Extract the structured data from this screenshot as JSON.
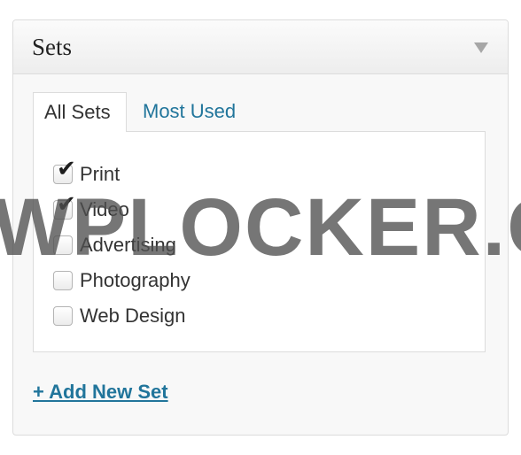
{
  "box": {
    "title": "Sets",
    "toggle_icon": "triangle-down-icon"
  },
  "tabs": [
    {
      "label": "All Sets",
      "active": true
    },
    {
      "label": "Most Used",
      "active": false
    }
  ],
  "categories": [
    {
      "label": "Print",
      "checked": true
    },
    {
      "label": "Video",
      "checked": true
    },
    {
      "label": "Advertising",
      "checked": false
    },
    {
      "label": "Photography",
      "checked": false
    },
    {
      "label": "Web Design",
      "checked": false
    }
  ],
  "add_link": "+ Add New Set",
  "watermark": "WPLOCKER.COM",
  "colors": {
    "link": "#21759b",
    "border": "#dcdcdc",
    "header_bg": "#f1f1f1"
  }
}
